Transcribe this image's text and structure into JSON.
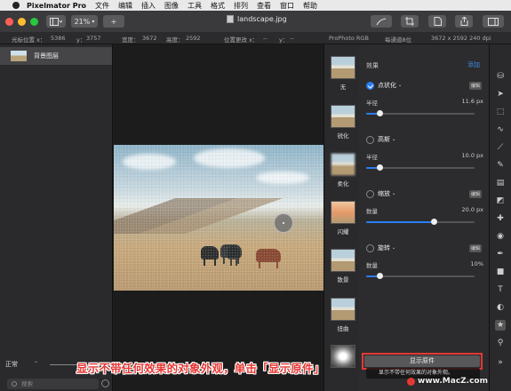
{
  "menubar": {
    "app_name": "Pixelmator Pro",
    "items": [
      "文件",
      "编辑",
      "插入",
      "图像",
      "工具",
      "格式",
      "排列",
      "查看",
      "窗口",
      "帮助"
    ]
  },
  "toolbar": {
    "zoom": "21%",
    "add_label": "+",
    "document_title": "landscape.jpg"
  },
  "info_bar": {
    "cursor_x_label": "光标位置 x：",
    "cursor_x": "5386",
    "cursor_y_label": "y：",
    "cursor_y": "3757",
    "width_label": "宽度：",
    "width": "3672",
    "height_label": "高度：",
    "height": "2592",
    "pos_change_label": "位置更改 x：",
    "pos_change_x": "--",
    "pos_change_y_label": "y：",
    "pos_change_y": "--",
    "color_profile": "ProPhoto RGB",
    "bit_depth": "每通道8位",
    "dimensions": "3672 x 2592 240 dpi"
  },
  "layers_panel": {
    "layer_name": "背景图层",
    "blend_mode": "正常",
    "search_placeholder": "搜索"
  },
  "presets": [
    {
      "label": "无"
    },
    {
      "label": "锐化"
    },
    {
      "label": "柔化"
    },
    {
      "label": "闪耀"
    },
    {
      "label": "散景"
    },
    {
      "label": "扭曲"
    }
  ],
  "effects_panel": {
    "header": "效果",
    "add_label": "添加",
    "effects": [
      {
        "name": "点状化",
        "enabled": true,
        "edit": "编辑",
        "param_label": "半径",
        "param_value": "11.6 px",
        "fraction": 0.12
      },
      {
        "name": "高斯",
        "enabled": false,
        "param_label": "半径",
        "param_value": "10.0 px",
        "fraction": 0.12
      },
      {
        "name": "缩放",
        "enabled": false,
        "edit": "编辑",
        "param_label": "数量",
        "param_value": "20.0 px",
        "fraction": 0.62
      },
      {
        "name": "旋转",
        "enabled": false,
        "edit": "编辑",
        "param_label": "数量",
        "param_value": "10%",
        "fraction": 0.12
      }
    ],
    "show_original_label": "显示原件",
    "tooltip_text": "显示不带任何效果的对象外观。"
  },
  "annotation": {
    "caption": "显示不带任何效果的对象外观，单击「显示原件」",
    "watermark": "www.MacZ.com"
  },
  "colors": {
    "accent": "#2a7ef0",
    "highlight": "#e53935"
  }
}
